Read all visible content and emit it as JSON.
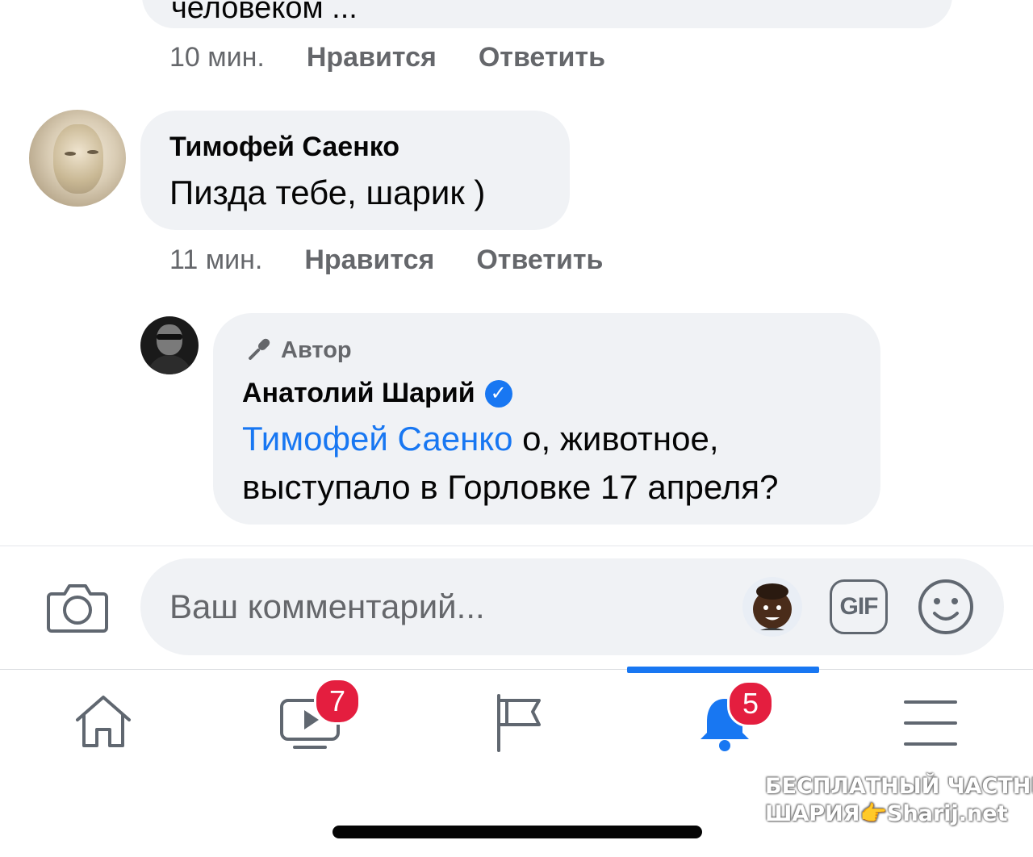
{
  "previous_comment": {
    "text": "человеком ...",
    "time": "10 мин.",
    "like_label": "Нравится",
    "reply_label": "Ответить"
  },
  "comment": {
    "author": "Тимофей Саенко",
    "text": "Пизда тебе, шарик )",
    "time": "11 мин.",
    "like_label": "Нравится",
    "reply_label": "Ответить"
  },
  "reply": {
    "badge": "Автор",
    "author": "Анатолий Шарий",
    "verified_icon": "check-icon",
    "mention": "Тимофей Саенко",
    "text": " о, животное, выступало в Горловке 17 апреля?"
  },
  "composer": {
    "placeholder": "Ваш комментарий...",
    "gif_label": "GIF"
  },
  "nav": {
    "tabs": [
      {
        "name": "home-icon",
        "badge": ""
      },
      {
        "name": "watch-icon",
        "badge": "7"
      },
      {
        "name": "pages-flag-icon",
        "badge": ""
      },
      {
        "name": "notifications-bell-icon",
        "badge": "5",
        "active": true
      },
      {
        "name": "menu-icon",
        "badge": ""
      }
    ]
  },
  "colors": {
    "accent": "#1877f2",
    "bubble": "#f0f2f5",
    "badge": "#e41e3f",
    "meta": "#65676b"
  },
  "watermark": {
    "line1": "БЕСПЛАТНЫЙ ЧАСТНЫЙ",
    "line2": "ШАРИЯ",
    "line2b": "Sharij.net"
  }
}
